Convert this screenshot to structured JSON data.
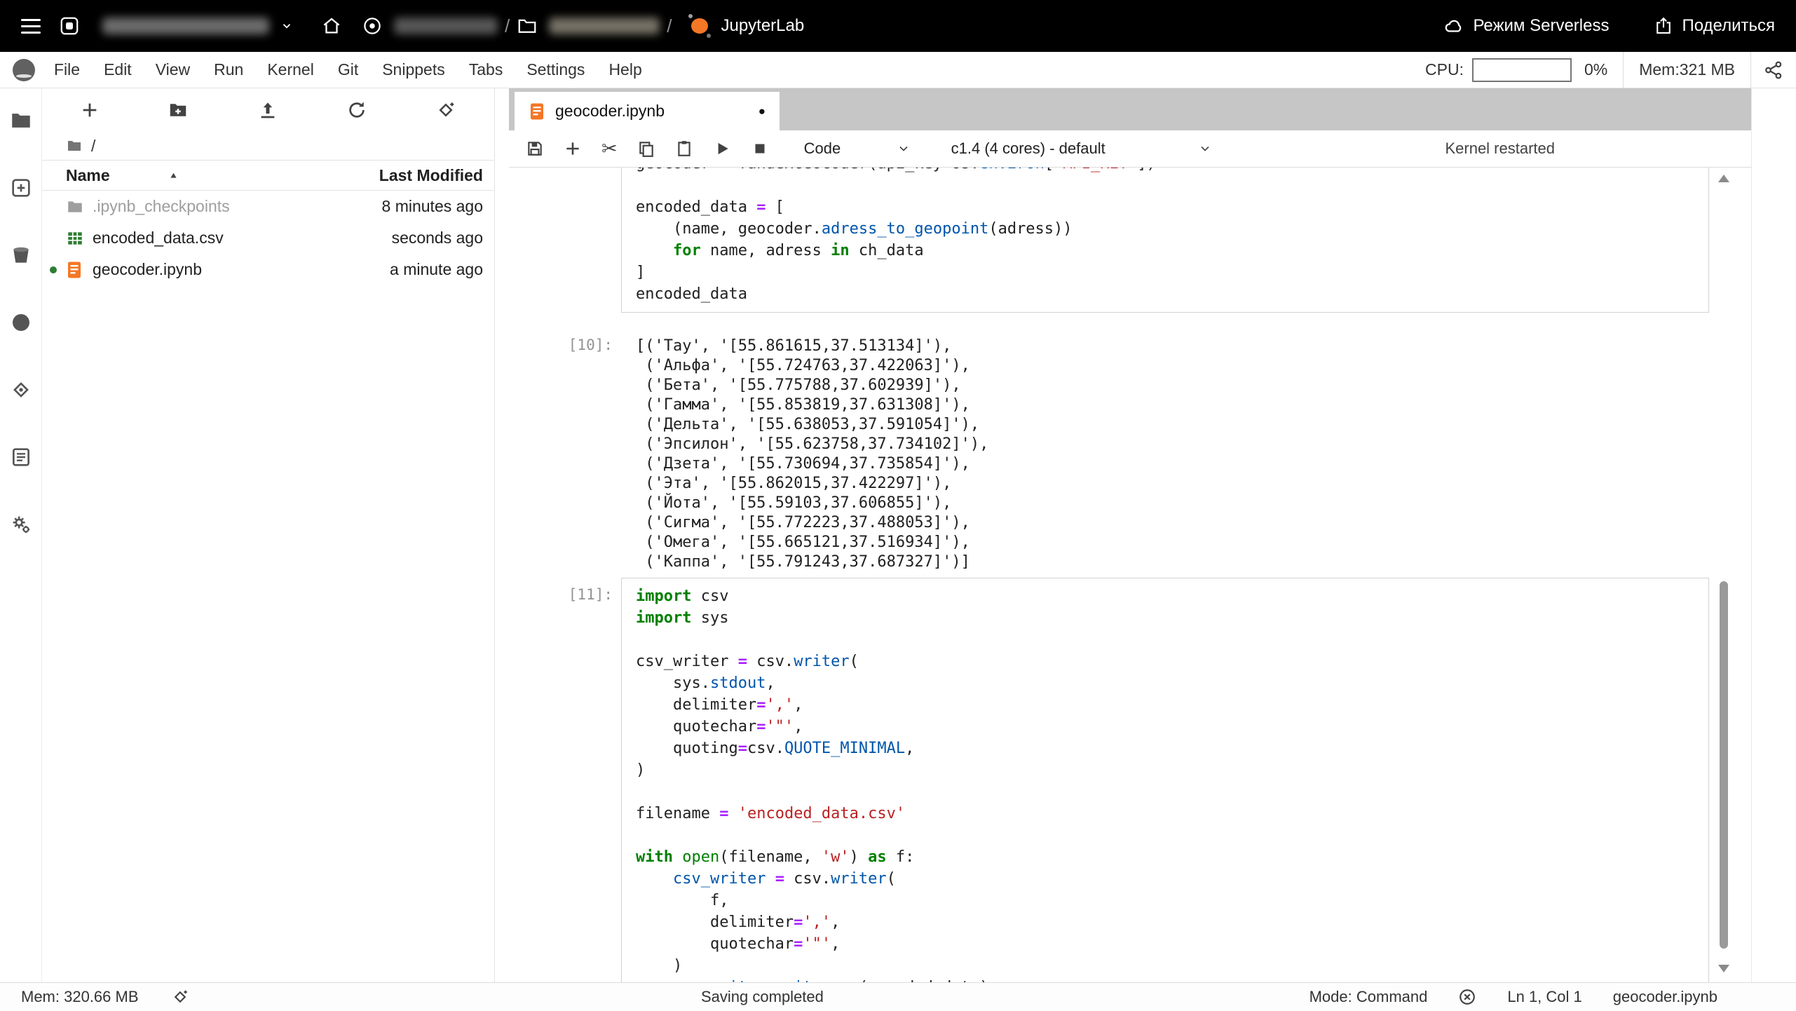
{
  "topbar": {
    "app_label": "JupyterLab",
    "separator": "/",
    "serverless_label": "Режим Serverless",
    "share_label": "Поделиться"
  },
  "menubar": {
    "items": [
      "File",
      "Edit",
      "View",
      "Run",
      "Kernel",
      "Git",
      "Snippets",
      "Tabs",
      "Settings",
      "Help"
    ],
    "cpu_label": "CPU:",
    "cpu_value": "0%",
    "mem_label": "Mem:321 MB"
  },
  "filebrowser": {
    "breadcrumb_root": "/",
    "columns": {
      "name": "Name",
      "modified": "Last Modified"
    },
    "files": [
      {
        "name": ".ipynb_checkpoints",
        "modified": "8 minutes ago",
        "icon": "folder",
        "dim": true,
        "running": false
      },
      {
        "name": "encoded_data.csv",
        "modified": "seconds ago",
        "icon": "csv",
        "dim": false,
        "running": false
      },
      {
        "name": "geocoder.ipynb",
        "modified": "a minute ago",
        "icon": "notebook",
        "dim": false,
        "running": true
      }
    ]
  },
  "editor": {
    "tab_title": "geocoder.ipynb",
    "dirty_indicator": "●",
    "cell_type": "Code",
    "kernel_selector": "c1.4 (4 cores) - default",
    "kernel_status": "Kernel restarted"
  },
  "notebook": {
    "cell_top": {
      "lines": [
        [
          [
            "v",
            "geocoder "
          ],
          [
            "o",
            "="
          ],
          [
            "v",
            " YandexGeocoder(api_key"
          ],
          [
            "o",
            "="
          ],
          [
            "v",
            "os."
          ],
          [
            "p",
            "environ"
          ],
          [
            "v",
            "["
          ],
          [
            "s",
            "'API_KEY'"
          ],
          [
            "v",
            "])"
          ]
        ],
        [],
        [
          [
            "v",
            "encoded_data "
          ],
          [
            "o",
            "="
          ],
          [
            "v",
            " ["
          ]
        ],
        [
          [
            "v",
            "    (name, geocoder."
          ],
          [
            "p",
            "adress_to_geopoint"
          ],
          [
            "v",
            "(adress))"
          ]
        ],
        [
          [
            "v",
            "    "
          ],
          [
            "k",
            "for"
          ],
          [
            "v",
            " name, adress "
          ],
          [
            "k",
            "in"
          ],
          [
            "v",
            " ch_data"
          ]
        ],
        [
          [
            "v",
            "]"
          ]
        ],
        [
          [
            "v",
            "encoded_data"
          ]
        ]
      ]
    },
    "out10": {
      "prompt": "[10]:",
      "lines": [
        "[('Тау', '[55.861615,37.513134]'),",
        " ('Альфа', '[55.724763,37.422063]'),",
        " ('Бета', '[55.775788,37.602939]'),",
        " ('Гамма', '[55.853819,37.631308]'),",
        " ('Дельта', '[55.638053,37.591054]'),",
        " ('Эпсилон', '[55.623758,37.734102]'),",
        " ('Дзета', '[55.730694,37.735854]'),",
        " ('Эта', '[55.862015,37.422297]'),",
        " ('Йота', '[55.59103,37.606855]'),",
        " ('Сигма', '[55.772223,37.488053]'),",
        " ('Омега', '[55.665121,37.516934]'),",
        " ('Каппа', '[55.791243,37.687327]')]"
      ]
    },
    "cell11": {
      "prompt": "[11]:",
      "lines": [
        [
          [
            "k",
            "import"
          ],
          [
            "v",
            " csv"
          ]
        ],
        [
          [
            "k",
            "import"
          ],
          [
            "v",
            " sys"
          ]
        ],
        [],
        [
          [
            "v",
            "csv_writer "
          ],
          [
            "o",
            "="
          ],
          [
            "v",
            " csv."
          ],
          [
            "p",
            "writer"
          ],
          [
            "v",
            "("
          ]
        ],
        [
          [
            "v",
            "    sys."
          ],
          [
            "p",
            "stdout"
          ],
          [
            "v",
            ","
          ]
        ],
        [
          [
            "v",
            "    delimiter"
          ],
          [
            "o",
            "="
          ],
          [
            "s",
            "','"
          ],
          [
            "v",
            ","
          ]
        ],
        [
          [
            "v",
            "    quotechar"
          ],
          [
            "o",
            "="
          ],
          [
            "s",
            "'\"'"
          ],
          [
            "v",
            ","
          ]
        ],
        [
          [
            "v",
            "    quoting"
          ],
          [
            "o",
            "="
          ],
          [
            "v",
            "csv."
          ],
          [
            "p",
            "QUOTE_MINIMAL"
          ],
          [
            "v",
            ","
          ]
        ],
        [
          [
            "v",
            ")"
          ]
        ],
        [],
        [
          [
            "v",
            "filename "
          ],
          [
            "o",
            "="
          ],
          [
            "v",
            " "
          ],
          [
            "s",
            "'encoded_data.csv'"
          ]
        ],
        [],
        [
          [
            "k",
            "with"
          ],
          [
            "v",
            " "
          ],
          [
            "b",
            "open"
          ],
          [
            "v",
            "(filename, "
          ],
          [
            "s",
            "'w'"
          ],
          [
            "v",
            ") "
          ],
          [
            "k",
            "as"
          ],
          [
            "v",
            " f:"
          ]
        ],
        [
          [
            "v",
            "    "
          ],
          [
            "p",
            "csv_writer"
          ],
          [
            "v",
            " "
          ],
          [
            "o",
            "="
          ],
          [
            "v",
            " csv."
          ],
          [
            "p",
            "writer"
          ],
          [
            "v",
            "("
          ]
        ],
        [
          [
            "v",
            "        f,"
          ]
        ],
        [
          [
            "v",
            "        delimiter"
          ],
          [
            "o",
            "="
          ],
          [
            "s",
            "','"
          ],
          [
            "v",
            ","
          ]
        ],
        [
          [
            "v",
            "        quotechar"
          ],
          [
            "o",
            "="
          ],
          [
            "s",
            "'\"'"
          ],
          [
            "v",
            ","
          ]
        ],
        [
          [
            "v",
            "    )"
          ]
        ],
        [
          [
            "v",
            "    "
          ],
          [
            "p",
            "csv_writer"
          ],
          [
            "v",
            "."
          ],
          [
            "p",
            "writerows"
          ],
          [
            "v",
            "(encoded_data)"
          ]
        ]
      ]
    }
  },
  "statusbar": {
    "mem": "Mem: 320.66 MB",
    "center": "Saving completed",
    "mode": "Mode: Command",
    "position": "Ln 1, Col 1",
    "filename": "geocoder.ipynb"
  },
  "colors": {
    "jupyter_orange": "#F37726",
    "csv_green": "#2E7D32",
    "keyword_green": "#008000",
    "string_red": "#BA2121",
    "operator_purple": "#AA22FF",
    "property_blue": "#0055aa",
    "topbar_black": "#000000",
    "tabstrip_gray": "#c6c6c6"
  }
}
